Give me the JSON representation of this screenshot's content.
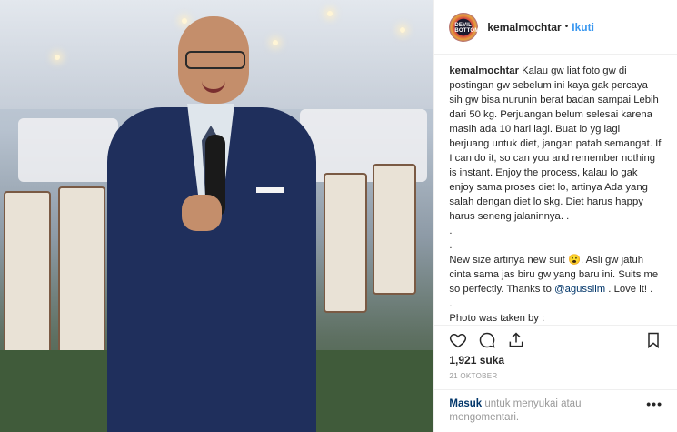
{
  "post": {
    "username": "kemalmochtar",
    "follow_label": "Ikuti",
    "separator": "•",
    "avatar_text": "DEVIL BOTTOM",
    "caption_text": "Kalau gw liat foto gw di postingan gw sebelum ini kaya gak percaya sih gw bisa nurunin berat badan sampai Lebih dari 50 kg. Perjuangan belum selesai karena masih ada 10 hari lagi. Buat lo yg lagi berjuang untuk diet, jangan patah semangat. If I can do it, so can you and remember nothing is instant. Enjoy the process, kalau lo gak enjoy sama proses diet lo, artinya Ada yang salah dengan diet lo skg. Diet harus happy harus seneng jalaninnya. .\n.\n.\nNew size artinya new suit 😮. Asli gw jatuh cinta sama jas biru gw yang baru ini. Suits me so perfectly. Thanks to ",
    "mention": "@agusslim",
    "caption_tail": " . Love it! .\n.\nPhoto was taken by :",
    "likes": "1,921 suka",
    "date": "21 OKTOBER",
    "comment_login": "Masuk",
    "comment_prompt": " untuk menyukai atau mengomentari.",
    "more_label": "•••"
  }
}
